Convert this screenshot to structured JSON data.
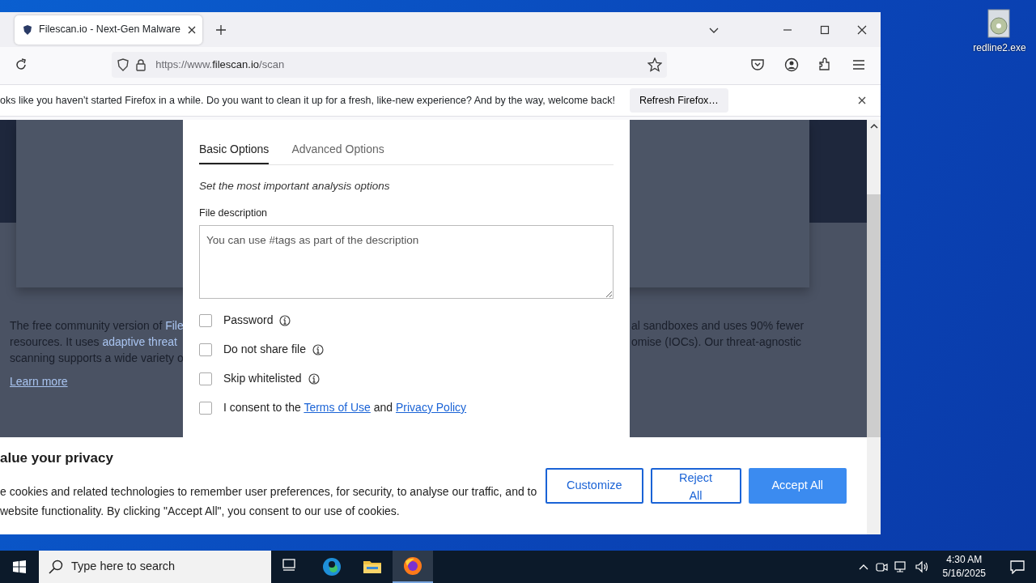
{
  "desktop": {
    "icons": [
      {
        "label": "redline2.exe"
      }
    ]
  },
  "browser": {
    "tabs": [
      {
        "title": "Filescan.io - Next-Gen Malware",
        "selected": true
      }
    ],
    "url": {
      "scheme": "https://www.",
      "domain": "filescan.io",
      "path": "/scan"
    },
    "notification": {
      "message": "oks like you haven’t started Firefox in a while. Do you want to clean it up for a fresh, like-new experience? And by the way, welcome back!",
      "button": "Refresh Firefox…"
    }
  },
  "page": {
    "left_lines": [
      [
        {
          "text": "The free community version of ",
          "link": false
        },
        {
          "text": "File",
          "link": true
        }
      ],
      [
        {
          "text": "resources. It uses ",
          "link": false
        },
        {
          "text": "adaptive threat",
          "link": true
        }
      ],
      [
        {
          "text": "scanning supports a wide variety o",
          "link": false
        }
      ]
    ],
    "right_lines": [
      "al sandboxes and uses 90% fewer",
      "omise (IOCs). Our threat-agnostic"
    ],
    "learn_more": "Learn more"
  },
  "modal": {
    "tabs": [
      {
        "label": "Basic Options",
        "selected": true
      },
      {
        "label": "Advanced Options",
        "selected": false
      }
    ],
    "subtitle": "Set the most important analysis options",
    "description_label": "File description",
    "description_placeholder": "You can use #tags as part of the description",
    "options": [
      {
        "label": "Password",
        "checked": false,
        "info": true
      },
      {
        "label": "Do not share file",
        "checked": false,
        "info": true
      },
      {
        "label": "Skip whitelisted",
        "checked": false,
        "info": true
      }
    ],
    "consent": {
      "checked": false,
      "parts": [
        {
          "text": "I consent to the ",
          "link": false
        },
        {
          "text": "Terms of Use",
          "link": true
        },
        {
          "text": " and ",
          "link": false
        },
        {
          "text": "Privacy Policy",
          "link": true
        }
      ]
    }
  },
  "cookie_banner": {
    "title": "alue your privacy",
    "text": "e cookies and related technologies to remember user preferences, for security, to analyse our traffic, and to website functionality. By clicking \"Accept All\", you consent to our use of cookies.",
    "buttons": [
      {
        "label": "Customize",
        "kind": "outline"
      },
      {
        "label": "Reject All",
        "kind": "outline"
      },
      {
        "label": "Accept All",
        "kind": "primary"
      }
    ]
  },
  "taskbar": {
    "search_placeholder": "Type here to search",
    "apps": [
      {
        "kind": "taskview",
        "active": false
      },
      {
        "kind": "edge",
        "active": false
      },
      {
        "kind": "explorer",
        "active": false
      },
      {
        "kind": "firefox",
        "active": true
      }
    ],
    "time": "4:30 AM",
    "date": "5/16/2025"
  }
}
